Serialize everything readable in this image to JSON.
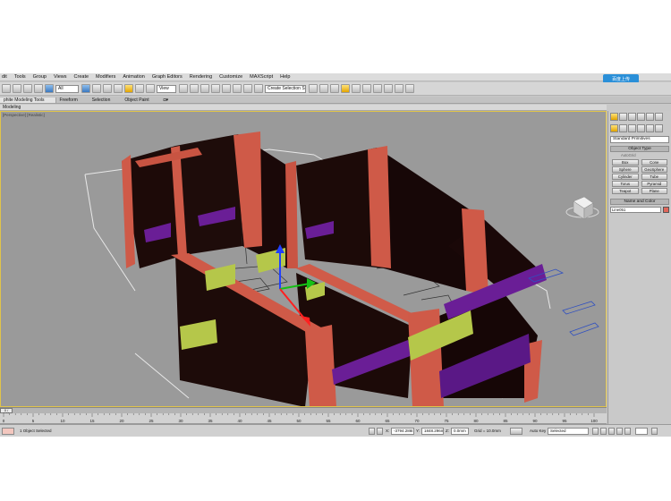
{
  "menu": {
    "items": [
      "dit",
      "Tools",
      "Group",
      "Views",
      "Create",
      "Modifiers",
      "Animation",
      "Graph Editors",
      "Rendering",
      "Customize",
      "MAXScript",
      "Help"
    ]
  },
  "badge": {
    "label": "百度上传"
  },
  "toolbar": {
    "filter_select": "All",
    "coord_select": "View",
    "selection_set": "Create Selection Set"
  },
  "ribbon": {
    "tabs": [
      "phite Modeling Tools",
      "Freeform",
      "Selection",
      "Object Paint"
    ],
    "sub_label": "Modeling"
  },
  "viewport": {
    "label": "[Perspective] [Realistic]"
  },
  "command_panel": {
    "category": "Standard Primitives",
    "object_type_title": "Object Type",
    "autogrid_label": "AutoGrid",
    "buttons": [
      "Box",
      "Cone",
      "Sphere",
      "GeoSphere",
      "Cylinder",
      "Tube",
      "Torus",
      "Pyramid",
      "Teapot",
      "Plane"
    ],
    "name_color_title": "Name and Color",
    "object_name": "Line051",
    "swatch_color": "#e0665a"
  },
  "timeline": {
    "frame_readout": "0 / 100",
    "ruler_ticks": [
      "0",
      "5",
      "10",
      "15",
      "20",
      "25",
      "30",
      "35",
      "40",
      "45",
      "50",
      "55",
      "60",
      "65",
      "70",
      "75",
      "80",
      "85",
      "90",
      "95",
      "100"
    ]
  },
  "status": {
    "selection_text": "1 Object Selected",
    "x_label": "X:",
    "x_value": "-3794.286t",
    "y_label": "Y:",
    "y_value": "1848.296m",
    "z_label": "Z:",
    "z_value": "0.0mm",
    "grid_text": "Grid = 10.0mm",
    "auto_key": "Auto Key",
    "selected_value": "Selected"
  },
  "colors": {
    "wall_dark": "#1d0a08",
    "wall_salmon": "#cf5a48",
    "lintel_purple": "#6a1e96",
    "lintel_green": "#b5c74a",
    "viewport_bg": "#9a9a9a"
  }
}
